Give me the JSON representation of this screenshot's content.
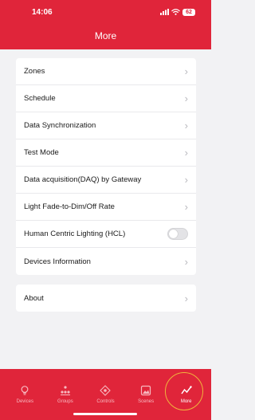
{
  "status": {
    "time": "14:06",
    "battery": "62"
  },
  "header": {
    "title": "More"
  },
  "menu": [
    {
      "label": "Zones"
    },
    {
      "label": "Schedule"
    },
    {
      "label": "Data Synchronization"
    },
    {
      "label": "Test Mode"
    },
    {
      "label": "Data acquisition(DAQ) by Gateway"
    },
    {
      "label": "Light Fade-to-Dim/Off Rate"
    },
    {
      "label": "Human Centric Lighting (HCL)",
      "toggle": false
    },
    {
      "label": "Devices Information"
    }
  ],
  "about": {
    "label": "About"
  },
  "tabs": [
    {
      "label": "Devices",
      "icon": "bulb-icon"
    },
    {
      "label": "Groups",
      "icon": "groups-icon"
    },
    {
      "label": "Controls",
      "icon": "controls-icon"
    },
    {
      "label": "Scenes",
      "icon": "scenes-icon"
    },
    {
      "label": "More",
      "icon": "more-icon",
      "active": true
    }
  ],
  "colors": {
    "brand": "#e0253a",
    "highlight": "#f0b43c"
  }
}
